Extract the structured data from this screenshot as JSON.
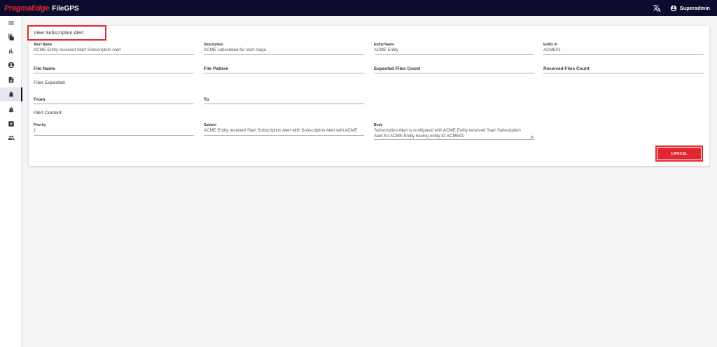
{
  "header": {
    "brand_logo": "PragmaEdge",
    "app_name": "FileGPS",
    "user_name": "Superadmin",
    "icons": {
      "translate": "translate-icon",
      "user": "account-circle-icon"
    },
    "brand_color": "#e3262f",
    "bar_color": "#0b0b2e"
  },
  "sidebar": {
    "items": [
      {
        "name": "menu-icon"
      },
      {
        "name": "files-icon"
      },
      {
        "name": "bar-chart-icon"
      },
      {
        "name": "account-icon"
      },
      {
        "name": "document-icon"
      },
      {
        "name": "bell-icon",
        "active": true
      },
      {
        "name": "notification-icon"
      },
      {
        "name": "settings-box-icon"
      },
      {
        "name": "users-icon"
      }
    ]
  },
  "form": {
    "title": "View Subscription Alert",
    "alert_name": {
      "label": "Alert Name",
      "value": "ACME Entity received Start Subscription Alert"
    },
    "description": {
      "label": "Description",
      "value": "ACME subscribed for start stage"
    },
    "entity_name": {
      "label": "Entity Name",
      "value": "ACME Entity"
    },
    "entity_id": {
      "label": "Entity Id",
      "value": "ACME01"
    },
    "file_name": {
      "label": "File Name"
    },
    "file_pattern": {
      "label": "File Pattern"
    },
    "expected_files_count": {
      "label": "Expected Files Count"
    },
    "received_files_count": {
      "label": "Received Files Count"
    },
    "files_expected_section": "Files Expected",
    "from": {
      "label": "From"
    },
    "to": {
      "label": "To"
    },
    "alert_content_section": "Alert Content",
    "priority": {
      "label": "Priority",
      "value": "1"
    },
    "subject": {
      "label": "Subject",
      "value": "ACME Entity received Start Subscription Alert with Subscription Alert with ACME"
    },
    "body": {
      "label": "Body",
      "value": "Subscription Alert is configured with ACME Entity received Start Subscription Alert for ACME Entity having entity ID ACME01"
    },
    "cancel_label": "CANCEL"
  }
}
